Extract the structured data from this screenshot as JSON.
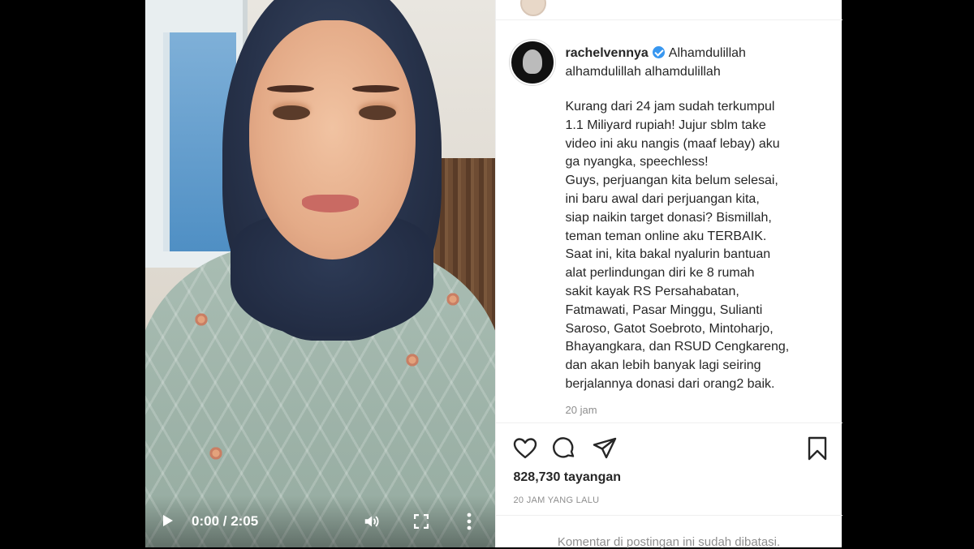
{
  "post": {
    "username": "rachelvennya",
    "caption_first": "Alhamdulillah alhamdulillah alhamdulillah",
    "body": "Kurang dari 24 jam sudah terkumpul\n1.1 Miliyard rupiah! Jujur sblm take\nvideo ini aku nangis (maaf lebay) aku\nga nyangka, speechless!\nGuys, perjuangan kita belum selesai,\nini baru awal dari perjuangan kita,\nsiap naikin target donasi? Bismillah,\nteman teman online aku TERBAIK.\nSaat ini, kita bakal nyalurin bantuan\nalat perlindungan diri ke 8 rumah\nsakit kayak RS Persahabatan,\nFatmawati, Pasar Minggu, Sulianti\nSaroso, Gatot Soebroto, Mintoharjo,\nBhayangkara, dan RSUD Cengkareng,\ndan akan lebih banyak lagi seiring\nberjalannya donasi dari orang2 baik.",
    "timestamp": "20 jam",
    "views": "828,730 tayangan",
    "posted_ago": "20 JAM YANG LALU",
    "comments_notice": "Komentar di postingan ini sudah dibatasi."
  },
  "video": {
    "time_display": "0:00 / 2:05"
  },
  "icons": {
    "like": "heart-icon",
    "comment": "comment-icon",
    "share": "send-icon",
    "save": "bookmark-icon",
    "play": "play-icon",
    "volume": "volume-icon",
    "fullscreen": "fullscreen-icon",
    "more": "more-vertical-icon"
  },
  "colors": {
    "verified": "#3897f0",
    "text": "#262626",
    "muted": "#8e8e8e"
  }
}
